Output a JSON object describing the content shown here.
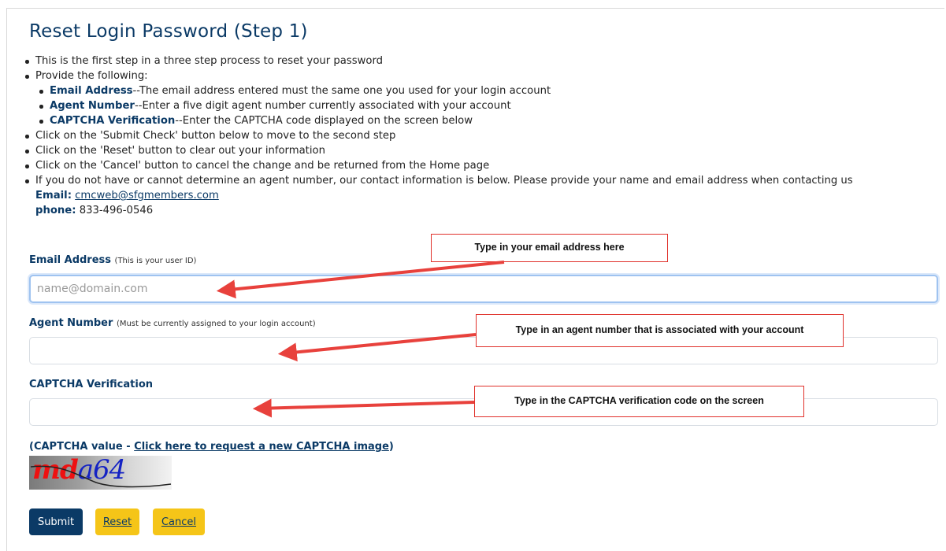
{
  "title": "Reset Login Password (Step 1)",
  "instructions": {
    "step_intro": "This is the first step in a three step process to reset your password",
    "provide": "Provide the following:",
    "items": [
      {
        "term": "Email Address",
        "desc": "--The email address entered must the same one you used for your login account"
      },
      {
        "term": "Agent Number",
        "desc": "--Enter a five digit agent number currently associated with your account"
      },
      {
        "term": "CAPTCHA Verification",
        "desc": "--Enter the CAPTCHA code displayed on the screen below"
      }
    ],
    "submit_note": "Click on the 'Submit Check' button below to move to the second step",
    "reset_note": "Click on the 'Reset' button to clear out your information",
    "cancel_note": "Click on the 'Cancel' button to cancel the change and be returned from the Home page",
    "contact_note": "If you do not have or cannot determine an agent number, our contact information is below.  Please provide your name and email address when contacting us",
    "contact": {
      "email_label": "Email:",
      "email": "cmcweb@sfgmembers.com",
      "phone_label": "phone:",
      "phone": "833-496-0546"
    }
  },
  "form": {
    "email": {
      "label": "Email Address",
      "hint": "(This is your user ID)",
      "placeholder": "name@domain.com",
      "value": ""
    },
    "agent": {
      "label": "Agent Number",
      "hint": "(Must be currently assigned to your login account)",
      "value": ""
    },
    "captcha": {
      "label": "CAPTCHA Verification",
      "value": ""
    },
    "captcha_prefix": "(CAPTCHA value - ",
    "captcha_link": "Click here to request a new CAPTCHA image",
    "captcha_suffix": ")",
    "captcha_image": {
      "part1": "md",
      "part2": "a64"
    }
  },
  "callouts": {
    "email": "Type in your email address here",
    "agent": "Type in an agent number that is associated with your account",
    "captcha": "Type in the CAPTCHA verification code on the screen"
  },
  "buttons": {
    "submit": "Submit",
    "reset": "Reset",
    "cancel": "Cancel"
  },
  "colors": {
    "heading": "#0b3a66",
    "primary_button": "#0b3a66",
    "secondary_button": "#f5c518",
    "callout_border": "#e0312b",
    "arrow": "#e8413c"
  }
}
